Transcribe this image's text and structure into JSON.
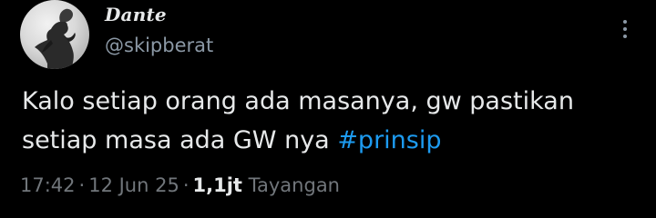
{
  "author": {
    "display_name": "Dante",
    "handle": "@skipberat",
    "avatar_icon": "avatar-silhouette-icon"
  },
  "tweet": {
    "text_line_1": "Kalo setiap orang ada masanya, gw pastikan",
    "text_line_2_prefix": "setiap masa ada GW nya ",
    "hashtag": "#prinsip"
  },
  "meta": {
    "time": "17:42",
    "separator_1": "·",
    "date": "12 Jun 25",
    "separator_2": "·",
    "views_count": "1,1jt",
    "views_label": "Tayangan"
  },
  "more_button_icon": "more-vertical-icon",
  "colors": {
    "background": "#000000",
    "primary_text": "#e7e9ea",
    "secondary_text": "#71767b",
    "hashtag": "#1d9bf0"
  }
}
